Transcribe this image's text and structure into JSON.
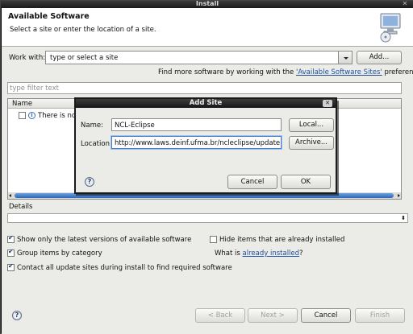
{
  "window": {
    "title": "Install",
    "close_glyph": "✕"
  },
  "header": {
    "title": "Available Software",
    "subtitle": "Select a site or enter the location of a site."
  },
  "work_with": {
    "label": "Work with:",
    "placeholder": "type or select a site",
    "add_label": "Add...",
    "hint_prefix": "Find more software by working with the ",
    "hint_link": "'Available Software Sites'",
    "hint_suffix": " preferences."
  },
  "filter": {
    "placeholder": "type filter text"
  },
  "tree": {
    "column_name": "Name",
    "row_text": "There is no s"
  },
  "details": {
    "label": "Details"
  },
  "options": {
    "show_latest": "Show only the latest versions of available software",
    "hide_installed": "Hide items that are already installed",
    "group_by_category": "Group items by category",
    "what_is_prefix": "What is ",
    "what_is_link": "already installed",
    "what_is_suffix": "?",
    "contact_sites": "Contact all update sites during install to find required software"
  },
  "footer": {
    "back": "< Back",
    "next": "Next >",
    "cancel": "Cancel",
    "finish": "Finish"
  },
  "dialog": {
    "title": "Add Site",
    "name_label": "Name:",
    "name_value": "NCL-Eclipse",
    "local_label": "Local...",
    "location_label": "Location:",
    "location_value": "http://www.laws.deinf.ufma.br/ncleclipse/update",
    "archive_label": "Archive...",
    "cancel_label": "Cancel",
    "ok_label": "OK"
  },
  "colors": {
    "link": "#1d4f9c",
    "accent": "#2b67b6"
  }
}
